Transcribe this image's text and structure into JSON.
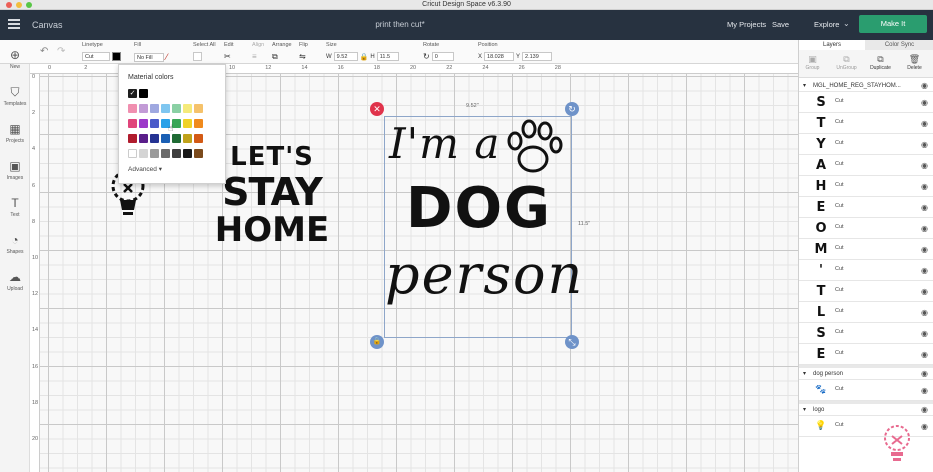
{
  "window": {
    "title": "Cricut Design Space  v6.3.90"
  },
  "header": {
    "canvas_label": "Canvas",
    "project_name": "print then cut*",
    "my_projects": "My Projects",
    "save": "Save",
    "explore": "Explore",
    "make_it": "Make It"
  },
  "toolbar": {
    "linetype": {
      "title": "Linetype",
      "value": "Cut"
    },
    "fill": {
      "title": "Fill",
      "value": "No Fill"
    },
    "select_all": "Select All",
    "edit": "Edit",
    "align": "Align",
    "arrange": "Arrange",
    "flip": "Flip",
    "size": {
      "title": "Size",
      "w_label": "W",
      "w": "9.52",
      "h_label": "H",
      "h": "11.5"
    },
    "rotate": {
      "title": "Rotate",
      "value": "0"
    },
    "position": {
      "title": "Position",
      "x_label": "X",
      "x": "18.028",
      "y_label": "Y",
      "y": "2.139"
    }
  },
  "sidebar": {
    "items": [
      {
        "label": "New",
        "icon": "plus-circle-icon"
      },
      {
        "label": "Templates",
        "icon": "shirt-icon"
      },
      {
        "label": "Projects",
        "icon": "grid-icon"
      },
      {
        "label": "Images",
        "icon": "image-icon"
      },
      {
        "label": "Text",
        "icon": "text-icon"
      },
      {
        "label": "Shapes",
        "icon": "shapes-icon"
      },
      {
        "label": "Upload",
        "icon": "upload-cloud-icon"
      }
    ]
  },
  "rulers": {
    "top": [
      "0",
      "2",
      "4",
      "6",
      "8",
      "10",
      "12",
      "14",
      "16",
      "18",
      "20",
      "22",
      "24",
      "26",
      "28"
    ],
    "left": [
      "0",
      "2",
      "4",
      "6",
      "8",
      "10",
      "12",
      "14",
      "16",
      "18",
      "20"
    ]
  },
  "color_popup": {
    "title": "Material colors",
    "advanced": "Advanced",
    "rows": [
      [
        "#1f1f1f",
        "#000000"
      ],
      [
        "#f08fb0",
        "#c29bd6",
        "#9fa8e0",
        "#7fc6f0",
        "#8ad0a4",
        "#f5ea7a",
        "#f5c26b"
      ],
      [
        "#e0457b",
        "#9c39c9",
        "#4a5ac9",
        "#2aa1e8",
        "#3aa657",
        "#f0d225",
        "#f08a1c"
      ],
      [
        "#b01c2e",
        "#5a1e8a",
        "#253393",
        "#1a5fb4",
        "#1f6b34",
        "#c0a21a",
        "#d35a15"
      ],
      [
        "#ffffff",
        "#d4d4d4",
        "#9a9a9a",
        "#6a6a6a",
        "#3f3f3f",
        "#1a1a1a",
        "#7b4a1c"
      ]
    ]
  },
  "canvas": {
    "art_lets_stay_home": [
      "LET'S",
      "STAY",
      "HOME"
    ],
    "art_dog_person": [
      "I'm a",
      "DOG",
      "person"
    ],
    "width_label": "9.52\"",
    "height_label": "11.5\""
  },
  "layers_panel": {
    "tab_layers": "Layers",
    "tab_color_sync": "Color Sync",
    "actions": [
      {
        "label": "Group",
        "icon": "group-icon",
        "enabled": false
      },
      {
        "label": "UnGroup",
        "icon": "ungroup-icon",
        "enabled": false
      },
      {
        "label": "Duplicate",
        "icon": "duplicate-icon",
        "enabled": true
      },
      {
        "label": "Delete",
        "icon": "trash-icon",
        "enabled": true
      }
    ],
    "group1": {
      "name": "MGL_HOME_REG_STAYHOM...",
      "layers": [
        {
          "letter": "S",
          "label": "Cut"
        },
        {
          "letter": "T",
          "label": "Cut"
        },
        {
          "letter": "Y",
          "label": "Cut"
        },
        {
          "letter": "A",
          "label": "Cut"
        },
        {
          "letter": "H",
          "label": "Cut"
        },
        {
          "letter": "E",
          "label": "Cut"
        },
        {
          "letter": "O",
          "label": "Cut"
        },
        {
          "letter": "M",
          "label": "Cut"
        },
        {
          "letter": "'",
          "label": "Cut"
        },
        {
          "letter": "T",
          "label": "Cut"
        },
        {
          "letter": "L",
          "label": "Cut"
        },
        {
          "letter": "S",
          "label": "Cut"
        },
        {
          "letter": "E",
          "label": "Cut"
        }
      ]
    },
    "group2": {
      "name": "dog person",
      "layer_label": "Cut"
    },
    "group3": {
      "name": "logo",
      "layer_label": "Cut"
    }
  },
  "colors": {
    "topbar": "#273240",
    "make_it": "#2a9d6f",
    "selection": "#8ea6c9",
    "delete_handle": "#e0334b",
    "handle": "#6f93c9",
    "watermark": "#e86a8f"
  }
}
